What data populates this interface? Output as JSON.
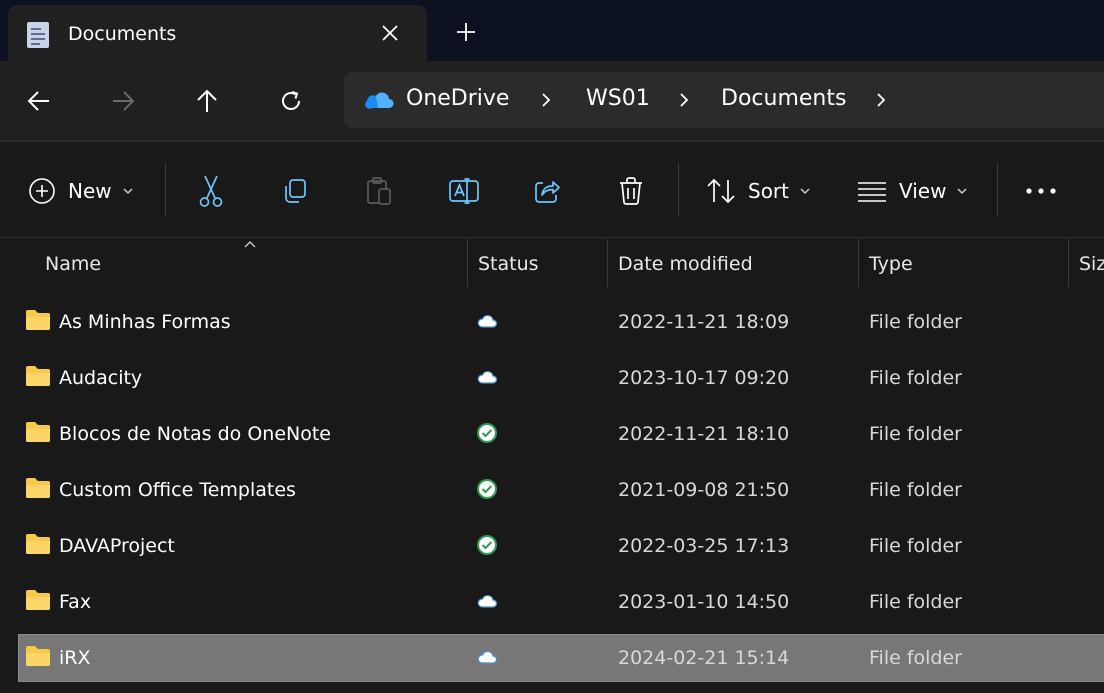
{
  "tab": {
    "title": "Documents",
    "icon": "document-icon"
  },
  "nav": {
    "back": "arrow-left-icon",
    "forward": "arrow-right-icon",
    "up": "arrow-up-icon",
    "refresh": "refresh-icon"
  },
  "breadcrumb": [
    "OneDrive",
    "WS01",
    "Documents"
  ],
  "toolbar": {
    "new_label": "New",
    "sort_label": "Sort",
    "view_label": "View"
  },
  "columns": {
    "name": "Name",
    "status": "Status",
    "date": "Date modified",
    "type": "Type",
    "size": "Siz"
  },
  "rows": [
    {
      "name": "As Minhas Formas",
      "status": "cloud",
      "date": "2022-11-21 18:09",
      "type": "File folder"
    },
    {
      "name": "Audacity",
      "status": "cloud",
      "date": "2023-10-17 09:20",
      "type": "File folder"
    },
    {
      "name": "Blocos de Notas do OneNote",
      "status": "synced",
      "date": "2022-11-21 18:10",
      "type": "File folder"
    },
    {
      "name": "Custom Office Templates",
      "status": "synced",
      "date": "2021-09-08 21:50",
      "type": "File folder"
    },
    {
      "name": "DAVAProject",
      "status": "synced",
      "date": "2022-03-25 17:13",
      "type": "File folder"
    },
    {
      "name": "Fax",
      "status": "cloud",
      "date": "2023-01-10 14:50",
      "type": "File folder"
    },
    {
      "name": "iRX",
      "status": "cloud",
      "date": "2024-02-21 15:14",
      "type": "File folder",
      "selected": true
    }
  ],
  "colors": {
    "accent": "#4cc2ff",
    "folder": "#f7c948",
    "synced": "#2e9b4a",
    "selected_row": "#777777"
  }
}
